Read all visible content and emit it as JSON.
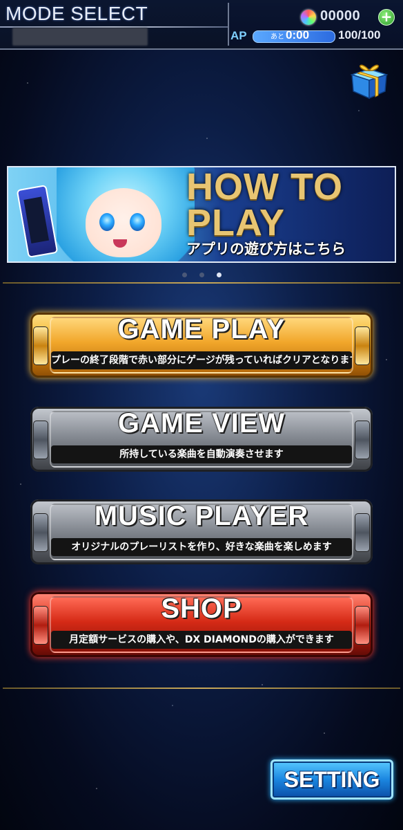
{
  "header": {
    "title": "MODE SELECT",
    "diamond_count": "00000",
    "add_symbol": "+",
    "ap_label": "AP",
    "ap_remaining_label": "あと",
    "ap_time": "0:00",
    "ap_value": "100/100",
    "ap_fill_percent": 100
  },
  "banner": {
    "title": "HOW TO PLAY",
    "subtitle": "アプリの遊び方はこちら",
    "page_count": 3,
    "active_page": 3
  },
  "menu": {
    "game_play": {
      "label": "GAME PLAY",
      "description": "プレーの終了段階で赤い部分にゲージが残っていればクリアとなります",
      "color": "#f3b52c"
    },
    "game_view": {
      "label": "GAME VIEW",
      "description": "所持している楽曲を自動演奏させます",
      "color": "#8d929a"
    },
    "music_player": {
      "label": "MUSIC PLAYER",
      "description": "オリジナルのプレーリストを作り、好きな楽曲を楽しめます",
      "color": "#8d929a"
    },
    "shop": {
      "label": "SHOP",
      "description": "月定額サービスの購入や、DX DIAMONDの購入ができます",
      "color": "#e23a22"
    }
  },
  "setting": {
    "label": "SETTING"
  }
}
